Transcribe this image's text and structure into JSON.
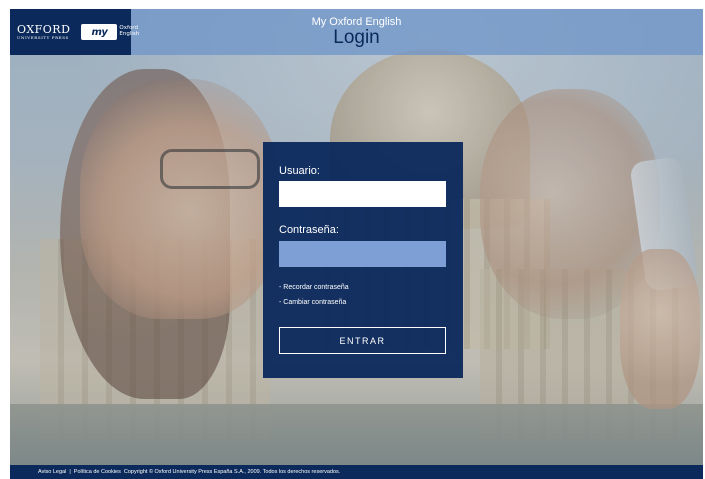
{
  "header": {
    "brand": {
      "oxford": "OXFORD",
      "oxford_sub": "UNIVERSITY PRESS",
      "my_mark": "my",
      "my_line1": "Oxford",
      "my_line2": "English"
    },
    "subtitle": "My Oxford English",
    "title": "Login"
  },
  "login": {
    "user_label": "Usuario:",
    "user_value": "",
    "pass_label": "Contraseña:",
    "pass_value": "",
    "remember_link": "- Recordar contraseña",
    "change_link": "- Cambiar contraseña",
    "submit": "ENTRAR"
  },
  "footer": {
    "legal_link": "Aviso Legal",
    "separator": "|",
    "cookies_link": "Política de Cookies",
    "copyright": "Copyright © Oxford University Press España S.A., 2009. Todos los derechos reservados."
  },
  "colors": {
    "navy": "#0b2a5b",
    "header_blue": "#7096c8",
    "password_field": "#7d9fd6"
  }
}
